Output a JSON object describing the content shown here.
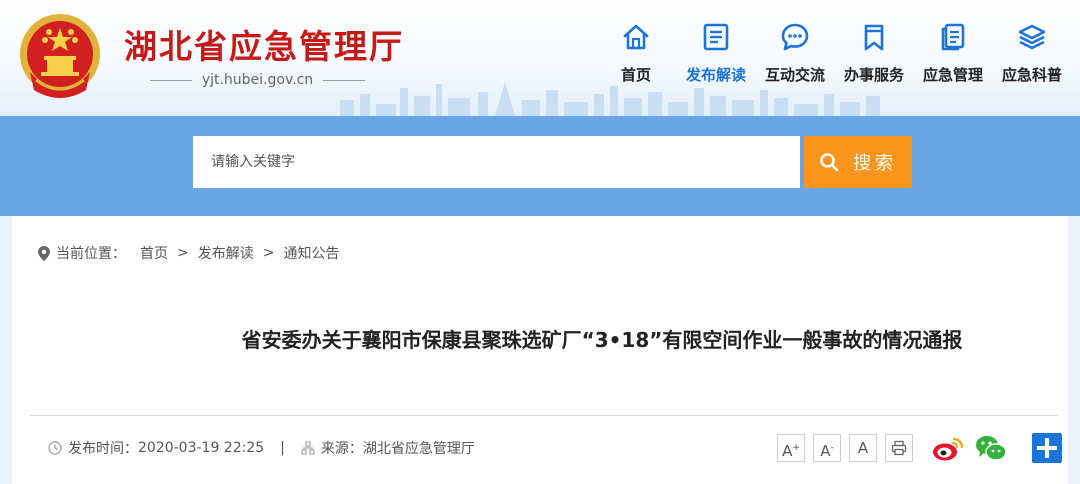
{
  "site": {
    "title": "湖北省应急管理厅",
    "domain": "yjt.hubei.gov.cn"
  },
  "nav": [
    {
      "label": "首页",
      "icon": "home-icon",
      "active": false
    },
    {
      "label": "发布解读",
      "icon": "document-icon",
      "active": true
    },
    {
      "label": "互动交流",
      "icon": "chat-icon",
      "active": false
    },
    {
      "label": "办事服务",
      "icon": "bookmark-icon",
      "active": false
    },
    {
      "label": "应急管理",
      "icon": "files-icon",
      "active": false
    },
    {
      "label": "应急科普",
      "icon": "layers-icon",
      "active": false
    }
  ],
  "search": {
    "placeholder": "请输入关键字",
    "button_label": "搜索"
  },
  "breadcrumb": {
    "label": "当前位置：",
    "items": [
      "首页",
      "发布解读",
      "通知公告"
    ],
    "separator": ">"
  },
  "article": {
    "title": "省安委办关于襄阳市保康县聚珠选矿厂“3•18”有限空间作业一般事故的情况通报",
    "publish_label": "发布时间：",
    "publish_time": "2020-03-19 22:25",
    "source_label": "来源：",
    "source": "湖北省应急管理厅"
  },
  "tools": {
    "font_large": "A",
    "font_large_mark": "+",
    "font_small": "A",
    "font_small_mark": "-",
    "font_reset": "A"
  },
  "colors": {
    "brand_red": "#c51a1a",
    "nav_blue": "#1d73d6",
    "search_band": "#6aa6e6",
    "search_button": "#f7951d"
  }
}
